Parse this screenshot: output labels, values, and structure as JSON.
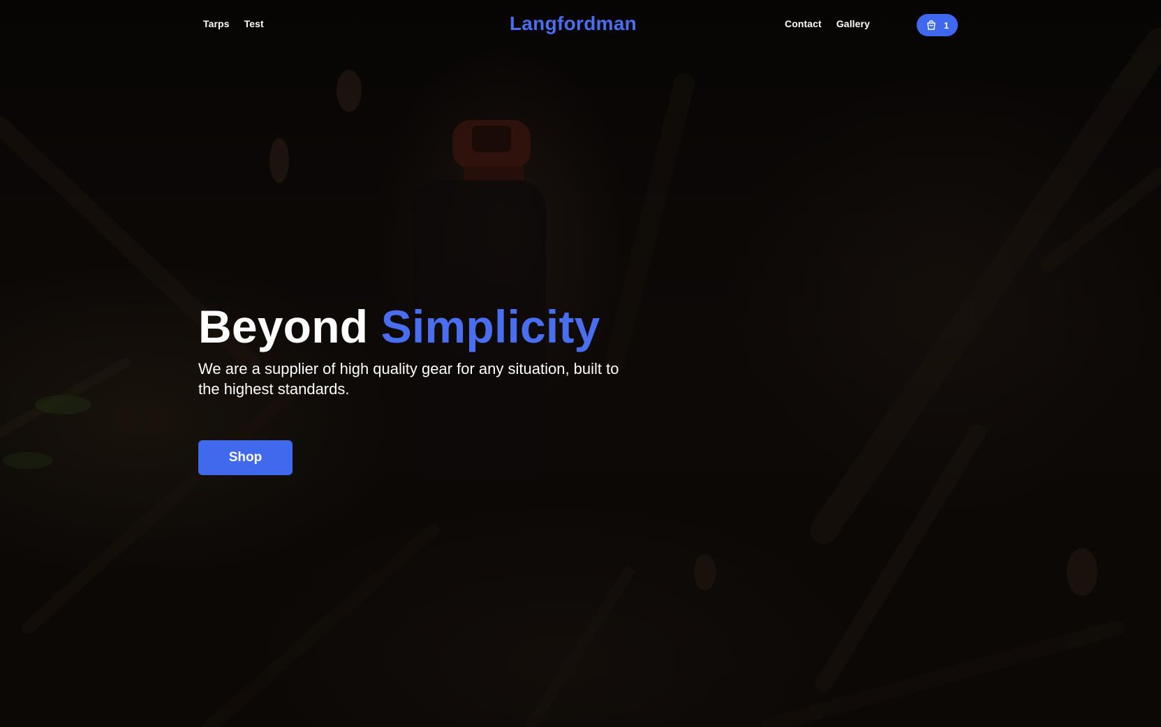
{
  "header": {
    "brand": "Langfordman",
    "nav_left": [
      {
        "label": "Tarps"
      },
      {
        "label": "Test"
      }
    ],
    "nav_right": [
      {
        "label": "Contact"
      },
      {
        "label": "Gallery"
      }
    ],
    "cart": {
      "icon": "shopping-bag-icon",
      "count": "1"
    }
  },
  "hero": {
    "title_white": "Beyond",
    "title_blue": "Simplicity",
    "subtitle": "We are a supplier of high quality gear for any situation, built to the highest standards.",
    "cta_label": "Shop"
  },
  "colors": {
    "accent": "#4a6ef0",
    "button": "#4169ee",
    "background": "#0a0706",
    "text": "#ffffff"
  }
}
